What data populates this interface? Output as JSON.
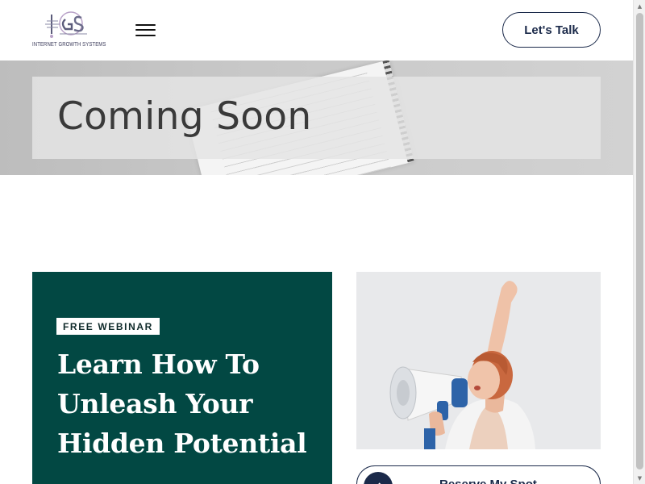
{
  "header": {
    "logo_mark": "IGS",
    "logo_text": "INTERNET GROWTH SYSTEMS",
    "menu_icon": "hamburger-menu-icon",
    "cta_label": "Let's Talk"
  },
  "hero": {
    "title": "Coming Soon"
  },
  "webinar": {
    "badge": "FREE WEBINAR",
    "title": "Learn How To Unleash Your Hidden Potential"
  },
  "promo_image": {
    "icon": "megaphone-woman-image"
  },
  "reserve": {
    "label": "Reserve My Spot",
    "icon": "arrow-right-icon"
  },
  "colors": {
    "brand_dark": "#1b2a4a",
    "webinar_bg": "#024843",
    "hero_panel": "#e4e4e4"
  }
}
